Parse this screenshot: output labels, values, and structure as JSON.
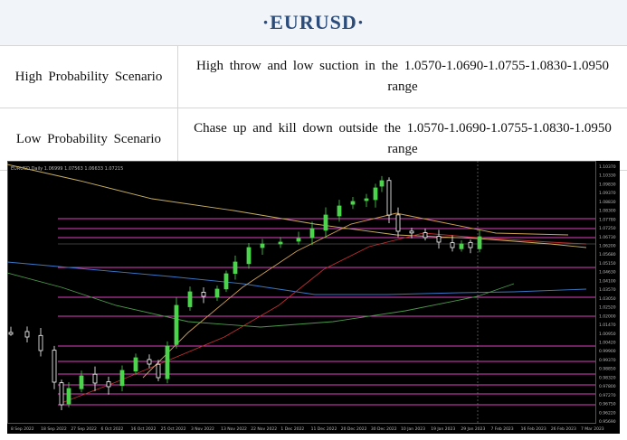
{
  "title": "·EURUSD·",
  "scenarios": [
    {
      "label": "High Probability Scenario",
      "text": "High throw and low suction in the 1.0570-1.0690-1.0755-1.0830-1.0950 range"
    },
    {
      "label": "Low Probability Scenario",
      "text": "Chase up and kill down outside the 1.0570-1.0690-1.0755-1.0830-1.0950 range"
    }
  ],
  "chart": {
    "header": "EURUSD,Daily  1.06999  1.07563  1.06633  1.07215",
    "x_labels": [
      "8 Sep 2022",
      "18 Sep 2022",
      "27 Sep 2022",
      "6 Oct 2022",
      "16 Oct 2022",
      "25 Oct 2022",
      "3 Nov 2022",
      "13 Nov 2022",
      "22 Nov 2022",
      "1 Dec 2022",
      "11 Dec 2022",
      "20 Dec 2022",
      "30 Dec 2022",
      "10 Jan 2023",
      "19 Jan 2023",
      "29 Jan 2023",
      "7 Feb 2023",
      "16 Feb 2023",
      "26 Feb 2023",
      "7 Mar 2023"
    ],
    "y_labels": [
      "1.10370",
      "1.10330",
      "1.09830",
      "1.09370",
      "1.08830",
      "1.08300",
      "1.07780",
      "1.07250",
      "1.06730",
      "1.06200",
      "1.05680",
      "1.05150",
      "1.04630",
      "1.04100",
      "1.03570",
      "1.03050",
      "1.02520",
      "1.02000",
      "1.01470",
      "1.00950",
      "1.00420",
      "0.99900",
      "0.99370",
      "0.98850",
      "0.98320",
      "0.97800",
      "0.97270",
      "0.96750",
      "0.96220",
      "0.95690"
    ],
    "colors": {
      "background": "#000000",
      "bull": "#4cd44c",
      "bear": "#ffffff",
      "levels": "#e040c0",
      "ma_fast": "#c8b060",
      "ma_mid": "#c03030",
      "ma_slow": "#3a78c8",
      "ma_slowest": "#4a9a4a",
      "axis_text": "#bbbbbb"
    }
  }
}
